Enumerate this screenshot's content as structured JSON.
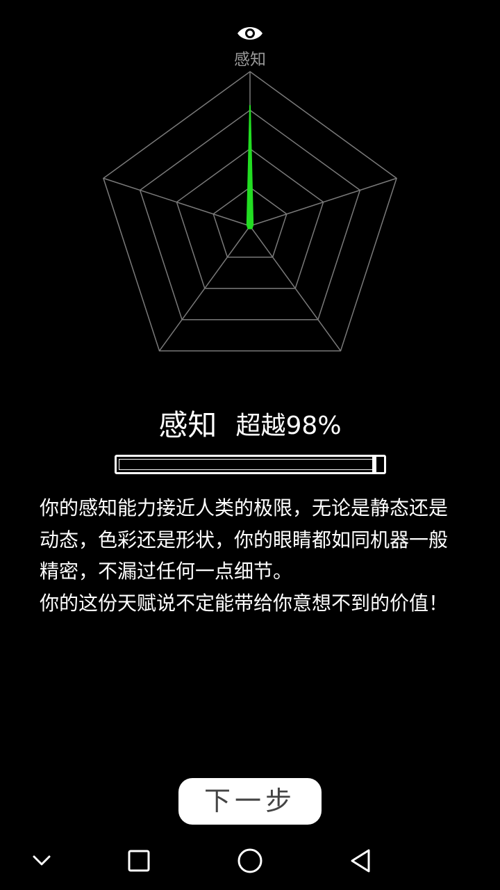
{
  "radar": {
    "axis_icon": "eye-icon",
    "top_axis_label": "感知",
    "value_color": "#22dd22",
    "grid_color": "#7a7a7a",
    "levels": 4,
    "values": [
      0.78,
      0.0,
      0.0,
      0.0,
      0.0
    ]
  },
  "result": {
    "trait": "感知",
    "beat_text": "超越98%",
    "progress": 0.98
  },
  "description": {
    "paragraph1": "你的感知能力接近人类的极限，无论是静态还是动态，色彩还是形状，你的眼睛都如同机器一般精密，不漏过任何一点细节。",
    "paragraph2": "你的这份天赋说不定能带给你意想不到的价值！"
  },
  "next_button": {
    "label": "下一步"
  },
  "navbar": {
    "icons": [
      "chevron-down-icon",
      "square-icon",
      "circle-icon",
      "back-triangle-icon"
    ]
  }
}
